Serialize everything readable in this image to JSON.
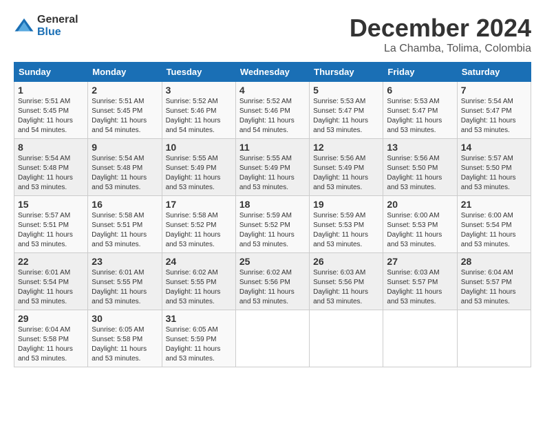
{
  "header": {
    "logo_general": "General",
    "logo_blue": "Blue",
    "month_title": "December 2024",
    "location": "La Chamba, Tolima, Colombia"
  },
  "days_of_week": [
    "Sunday",
    "Monday",
    "Tuesday",
    "Wednesday",
    "Thursday",
    "Friday",
    "Saturday"
  ],
  "weeks": [
    [
      {
        "day": "1",
        "info": "Sunrise: 5:51 AM\nSunset: 5:45 PM\nDaylight: 11 hours\nand 54 minutes."
      },
      {
        "day": "2",
        "info": "Sunrise: 5:51 AM\nSunset: 5:45 PM\nDaylight: 11 hours\nand 54 minutes."
      },
      {
        "day": "3",
        "info": "Sunrise: 5:52 AM\nSunset: 5:46 PM\nDaylight: 11 hours\nand 54 minutes."
      },
      {
        "day": "4",
        "info": "Sunrise: 5:52 AM\nSunset: 5:46 PM\nDaylight: 11 hours\nand 54 minutes."
      },
      {
        "day": "5",
        "info": "Sunrise: 5:53 AM\nSunset: 5:47 PM\nDaylight: 11 hours\nand 53 minutes."
      },
      {
        "day": "6",
        "info": "Sunrise: 5:53 AM\nSunset: 5:47 PM\nDaylight: 11 hours\nand 53 minutes."
      },
      {
        "day": "7",
        "info": "Sunrise: 5:54 AM\nSunset: 5:47 PM\nDaylight: 11 hours\nand 53 minutes."
      }
    ],
    [
      {
        "day": "8",
        "info": "Sunrise: 5:54 AM\nSunset: 5:48 PM\nDaylight: 11 hours\nand 53 minutes."
      },
      {
        "day": "9",
        "info": "Sunrise: 5:54 AM\nSunset: 5:48 PM\nDaylight: 11 hours\nand 53 minutes."
      },
      {
        "day": "10",
        "info": "Sunrise: 5:55 AM\nSunset: 5:49 PM\nDaylight: 11 hours\nand 53 minutes."
      },
      {
        "day": "11",
        "info": "Sunrise: 5:55 AM\nSunset: 5:49 PM\nDaylight: 11 hours\nand 53 minutes."
      },
      {
        "day": "12",
        "info": "Sunrise: 5:56 AM\nSunset: 5:49 PM\nDaylight: 11 hours\nand 53 minutes."
      },
      {
        "day": "13",
        "info": "Sunrise: 5:56 AM\nSunset: 5:50 PM\nDaylight: 11 hours\nand 53 minutes."
      },
      {
        "day": "14",
        "info": "Sunrise: 5:57 AM\nSunset: 5:50 PM\nDaylight: 11 hours\nand 53 minutes."
      }
    ],
    [
      {
        "day": "15",
        "info": "Sunrise: 5:57 AM\nSunset: 5:51 PM\nDaylight: 11 hours\nand 53 minutes."
      },
      {
        "day": "16",
        "info": "Sunrise: 5:58 AM\nSunset: 5:51 PM\nDaylight: 11 hours\nand 53 minutes."
      },
      {
        "day": "17",
        "info": "Sunrise: 5:58 AM\nSunset: 5:52 PM\nDaylight: 11 hours\nand 53 minutes."
      },
      {
        "day": "18",
        "info": "Sunrise: 5:59 AM\nSunset: 5:52 PM\nDaylight: 11 hours\nand 53 minutes."
      },
      {
        "day": "19",
        "info": "Sunrise: 5:59 AM\nSunset: 5:53 PM\nDaylight: 11 hours\nand 53 minutes."
      },
      {
        "day": "20",
        "info": "Sunrise: 6:00 AM\nSunset: 5:53 PM\nDaylight: 11 hours\nand 53 minutes."
      },
      {
        "day": "21",
        "info": "Sunrise: 6:00 AM\nSunset: 5:54 PM\nDaylight: 11 hours\nand 53 minutes."
      }
    ],
    [
      {
        "day": "22",
        "info": "Sunrise: 6:01 AM\nSunset: 5:54 PM\nDaylight: 11 hours\nand 53 minutes."
      },
      {
        "day": "23",
        "info": "Sunrise: 6:01 AM\nSunset: 5:55 PM\nDaylight: 11 hours\nand 53 minutes."
      },
      {
        "day": "24",
        "info": "Sunrise: 6:02 AM\nSunset: 5:55 PM\nDaylight: 11 hours\nand 53 minutes."
      },
      {
        "day": "25",
        "info": "Sunrise: 6:02 AM\nSunset: 5:56 PM\nDaylight: 11 hours\nand 53 minutes."
      },
      {
        "day": "26",
        "info": "Sunrise: 6:03 AM\nSunset: 5:56 PM\nDaylight: 11 hours\nand 53 minutes."
      },
      {
        "day": "27",
        "info": "Sunrise: 6:03 AM\nSunset: 5:57 PM\nDaylight: 11 hours\nand 53 minutes."
      },
      {
        "day": "28",
        "info": "Sunrise: 6:04 AM\nSunset: 5:57 PM\nDaylight: 11 hours\nand 53 minutes."
      }
    ],
    [
      {
        "day": "29",
        "info": "Sunrise: 6:04 AM\nSunset: 5:58 PM\nDaylight: 11 hours\nand 53 minutes."
      },
      {
        "day": "30",
        "info": "Sunrise: 6:05 AM\nSunset: 5:58 PM\nDaylight: 11 hours\nand 53 minutes."
      },
      {
        "day": "31",
        "info": "Sunrise: 6:05 AM\nSunset: 5:59 PM\nDaylight: 11 hours\nand 53 minutes."
      },
      {
        "day": "",
        "info": ""
      },
      {
        "day": "",
        "info": ""
      },
      {
        "day": "",
        "info": ""
      },
      {
        "day": "",
        "info": ""
      }
    ]
  ]
}
